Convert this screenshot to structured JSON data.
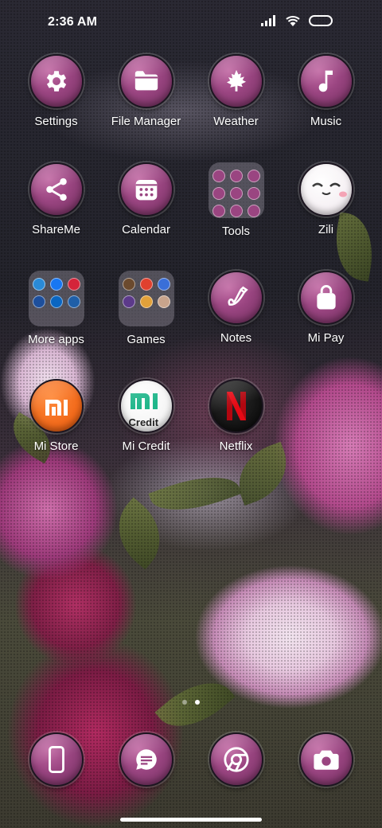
{
  "status_bar": {
    "time": "2:36 AM",
    "icons": [
      "signal-icon",
      "wifi-icon",
      "battery-icon"
    ]
  },
  "apps": [
    {
      "name": "settings",
      "label": "Settings",
      "icon": "gear-icon"
    },
    {
      "name": "file-manager",
      "label": "File Manager",
      "icon": "folder-icon"
    },
    {
      "name": "weather",
      "label": "Weather",
      "icon": "maple-leaf-icon"
    },
    {
      "name": "music",
      "label": "Music",
      "icon": "music-note-icon"
    },
    {
      "name": "shareme",
      "label": "ShareMe",
      "icon": "share-icon"
    },
    {
      "name": "calendar",
      "label": "Calendar",
      "icon": "calendar-icon"
    },
    {
      "name": "tools",
      "label": "Tools",
      "icon": "folder-tools"
    },
    {
      "name": "zili",
      "label": "Zili",
      "icon": "smiley-face-icon"
    },
    {
      "name": "more-apps",
      "label": "More apps",
      "icon": "folder-more-apps"
    },
    {
      "name": "games",
      "label": "Games",
      "icon": "folder-games"
    },
    {
      "name": "notes",
      "label": "Notes",
      "icon": "pen-icon"
    },
    {
      "name": "mi-pay",
      "label": "Mi Pay",
      "icon": "shopping-bag-icon"
    },
    {
      "name": "mi-store",
      "label": "Mi Store",
      "icon": "mi-logo-icon"
    },
    {
      "name": "mi-credit",
      "label": "Mi Credit",
      "icon": "mi-credit-icon"
    },
    {
      "name": "netflix",
      "label": "Netflix",
      "icon": "netflix-icon"
    }
  ],
  "mi_credit_text": "Credit",
  "page_indicator": {
    "pages": 2,
    "active": 2
  },
  "dock": [
    {
      "name": "phone",
      "icon": "phone-icon"
    },
    {
      "name": "messages",
      "icon": "message-icon"
    },
    {
      "name": "chrome",
      "icon": "chrome-icon"
    },
    {
      "name": "camera",
      "icon": "camera-icon"
    }
  ],
  "colors": {
    "icon_accent": "#9a4581",
    "mi_store_orange": "#f26a1b",
    "netflix_red": "#e50914",
    "mi_credit_green": "#1fb68a"
  }
}
